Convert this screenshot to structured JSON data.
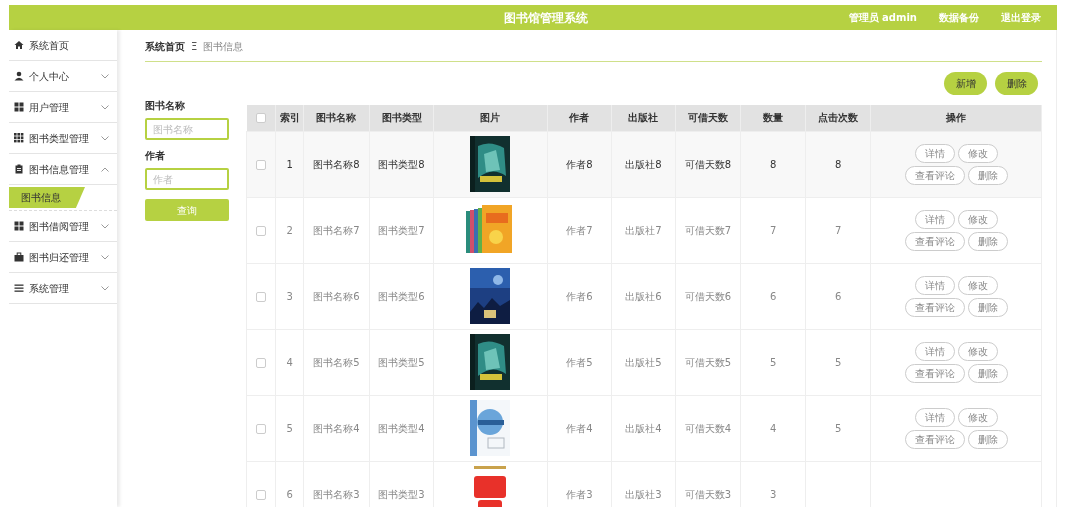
{
  "header": {
    "title": "图书馆管理系统",
    "links": [
      "管理员 admin",
      "数据备份",
      "退出登录"
    ]
  },
  "sidebar": {
    "items": [
      {
        "label": "系统首页",
        "kind": "link"
      },
      {
        "label": "个人中心",
        "kind": "menu",
        "expanded": false
      },
      {
        "label": "用户管理",
        "kind": "menu",
        "expanded": false
      },
      {
        "label": "图书类型管理",
        "kind": "menu",
        "expanded": false
      },
      {
        "label": "图书信息管理",
        "kind": "menu",
        "expanded": true,
        "children": [
          {
            "label": "图书信息",
            "selected": true
          }
        ]
      },
      {
        "label": "图书借阅管理",
        "kind": "menu",
        "expanded": false
      },
      {
        "label": "图书归还管理",
        "kind": "menu",
        "expanded": false
      },
      {
        "label": "系统管理",
        "kind": "menu",
        "expanded": false
      }
    ]
  },
  "breadcrumb": {
    "items": [
      "系统首页",
      "图书信息"
    ],
    "separator": "Ξ"
  },
  "search": {
    "fields": [
      {
        "label": "图书名称",
        "placeholder": "图书名称"
      },
      {
        "label": "作者",
        "placeholder": "作者"
      }
    ],
    "button": "查询"
  },
  "toolbar": {
    "buttons": [
      "新增",
      "删除"
    ]
  },
  "table": {
    "select_all_checked": false,
    "columns": [
      "索引",
      "图书名称",
      "图书类型",
      "图片",
      "作者",
      "出版社",
      "可借天数",
      "数量",
      "点击次数",
      "操作"
    ],
    "rows": [
      {
        "checked": false,
        "highlighted": true,
        "index": "1",
        "name": "图书名称8",
        "type": "图书类型8",
        "author": "作者8",
        "publisher": "出版社8",
        "loan_days": "可借天数8",
        "quantity": "8",
        "clicks": "8",
        "actions": [
          "详情",
          "修改",
          "查看评论",
          "删除"
        ]
      },
      {
        "checked": false,
        "highlighted": false,
        "index": "2",
        "name": "图书名称7",
        "type": "图书类型7",
        "author": "作者7",
        "publisher": "出版社7",
        "loan_days": "可借天数7",
        "quantity": "7",
        "clicks": "7",
        "actions": [
          "详情",
          "修改",
          "查看评论",
          "删除"
        ]
      },
      {
        "checked": false,
        "highlighted": false,
        "index": "3",
        "name": "图书名称6",
        "type": "图书类型6",
        "author": "作者6",
        "publisher": "出版社6",
        "loan_days": "可借天数6",
        "quantity": "6",
        "clicks": "6",
        "actions": [
          "详情",
          "修改",
          "查看评论",
          "删除"
        ]
      },
      {
        "checked": false,
        "highlighted": false,
        "index": "4",
        "name": "图书名称5",
        "type": "图书类型5",
        "author": "作者5",
        "publisher": "出版社5",
        "loan_days": "可借天数5",
        "quantity": "5",
        "clicks": "5",
        "actions": [
          "详情",
          "修改",
          "查看评论",
          "删除"
        ]
      },
      {
        "checked": false,
        "highlighted": false,
        "index": "5",
        "name": "图书名称4",
        "type": "图书类型4",
        "author": "作者4",
        "publisher": "出版社4",
        "loan_days": "可借天数4",
        "quantity": "4",
        "clicks": "5",
        "actions": [
          "详情",
          "修改",
          "查看评论",
          "删除"
        ]
      },
      {
        "checked": false,
        "highlighted": false,
        "index": "6",
        "name": "图书名称3",
        "type": "图书类型3",
        "author": "作者3",
        "publisher": "出版社3",
        "loan_days": "可借天数3",
        "quantity": "3"
      }
    ]
  }
}
